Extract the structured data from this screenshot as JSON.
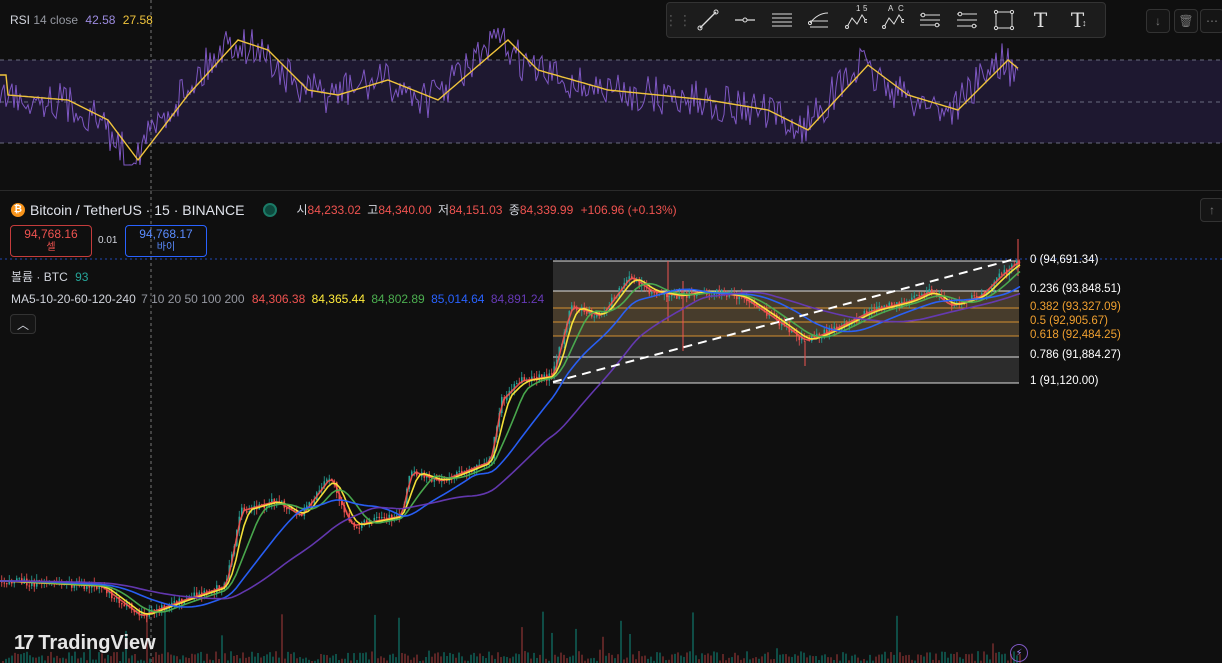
{
  "rsi": {
    "name": "RSI",
    "params": "14 close",
    "value1": "42.58",
    "value2": "27.58",
    "colors": {
      "rsi": "#7e57c2",
      "ma": "#f0c43c",
      "band": "#2a1f3d"
    }
  },
  "symbol": {
    "title": "Bitcoin / TetherUS · 15 · BINANCE",
    "open_label": "시",
    "open": "84,233.02",
    "high_label": "고",
    "high": "84,340.00",
    "low_label": "저",
    "low": "84,151.03",
    "close_label": "종",
    "close": "84,339.99",
    "change": "+106.96 (+0.13%)"
  },
  "trade": {
    "sell_price": "94,768.16",
    "sell_label": "셀",
    "spread": "0.01",
    "buy_price": "94,768.17",
    "buy_label": "바이"
  },
  "volume": {
    "label": "볼륨 · BTC",
    "value": "93"
  },
  "ma": {
    "label": "MA5-10-20-60-120-240",
    "periods": "7 10 20 50 100 200",
    "values": [
      "84,306.38",
      "84,365.44",
      "84,802.89",
      "85,014.64",
      "84,891.24"
    ],
    "colors": [
      "#ef5350",
      "#ffeb3b",
      "#4caf50",
      "#2962ff",
      "#673ab7"
    ]
  },
  "fib": {
    "levels": [
      {
        "label": "0 (94,691.34)",
        "color": "#ffffff"
      },
      {
        "label": "0.236 (93,848.51)",
        "color": "#ffffff"
      },
      {
        "label": "0.382 (93,327.09)",
        "color": "#f0a030"
      },
      {
        "label": "0.5 (92,905.67)",
        "color": "#f0a030"
      },
      {
        "label": "0.618 (92,484.25)",
        "color": "#f0a030"
      },
      {
        "label": "0.786 (91,884.27)",
        "color": "#ffffff"
      },
      {
        "label": "1 (91,120.00)",
        "color": "#ffffff"
      }
    ]
  },
  "toolbar": {
    "tools": [
      "trend-line-icon",
      "horizontal-ray-icon",
      "parallel-channel-icon",
      "fib-retracement-icon",
      "xabcd-pattern-icon",
      "abcd-pattern-icon",
      "elliott-wave-icon",
      "fib-extension-icon",
      "rectangle-icon",
      "text-icon",
      "text-note-icon"
    ],
    "pattern_num_1": "1",
    "pattern_num_5": "5",
    "pattern_a": "A",
    "pattern_c": "C",
    "text_glyph": "T"
  },
  "logo": "TradingView",
  "colors": {
    "up": "#26a69a",
    "down": "#ef5350",
    "bg": "#0f0f0f"
  }
}
